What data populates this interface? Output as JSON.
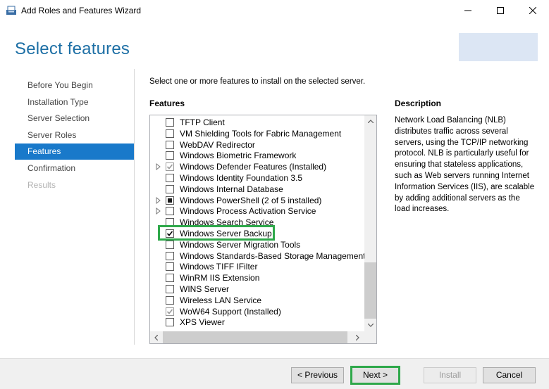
{
  "window": {
    "title": "Add Roles and Features Wizard"
  },
  "page": {
    "title": "Select features"
  },
  "nav": {
    "items": [
      {
        "label": "Before You Begin",
        "state": "normal"
      },
      {
        "label": "Installation Type",
        "state": "normal"
      },
      {
        "label": "Server Selection",
        "state": "normal"
      },
      {
        "label": "Server Roles",
        "state": "normal"
      },
      {
        "label": "Features",
        "state": "active"
      },
      {
        "label": "Confirmation",
        "state": "normal"
      },
      {
        "label": "Results",
        "state": "disabled"
      }
    ]
  },
  "content": {
    "instruction": "Select one or more features to install on the selected server.",
    "features_heading": "Features",
    "description_heading": "Description",
    "description_text": "Network Load Balancing (NLB) distributes traffic across several servers, using the TCP/IP networking protocol. NLB is particularly useful for ensuring that stateless applications, such as Web servers running Internet Information Services (IIS), are scalable by adding additional servers as the load increases."
  },
  "features": [
    {
      "label": "TFTP Client",
      "checked": "none",
      "expandable": false
    },
    {
      "label": "VM Shielding Tools for Fabric Management",
      "checked": "none",
      "expandable": false
    },
    {
      "label": "WebDAV Redirector",
      "checked": "none",
      "expandable": false
    },
    {
      "label": "Windows Biometric Framework",
      "checked": "none",
      "expandable": false
    },
    {
      "label": "Windows Defender Features (Installed)",
      "checked": "installed",
      "expandable": true
    },
    {
      "label": "Windows Identity Foundation 3.5",
      "checked": "none",
      "expandable": false
    },
    {
      "label": "Windows Internal Database",
      "checked": "none",
      "expandable": false
    },
    {
      "label": "Windows PowerShell (2 of 5 installed)",
      "checked": "partial",
      "expandable": true
    },
    {
      "label": "Windows Process Activation Service",
      "checked": "none",
      "expandable": true
    },
    {
      "label": "Windows Search Service",
      "checked": "none",
      "expandable": false
    },
    {
      "label": "Windows Server Backup",
      "checked": "checked",
      "expandable": false
    },
    {
      "label": "Windows Server Migration Tools",
      "checked": "none",
      "expandable": false
    },
    {
      "label": "Windows Standards-Based Storage Management",
      "checked": "none",
      "expandable": false
    },
    {
      "label": "Windows TIFF IFilter",
      "checked": "none",
      "expandable": false
    },
    {
      "label": "WinRM IIS Extension",
      "checked": "none",
      "expandable": false
    },
    {
      "label": "WINS Server",
      "checked": "none",
      "expandable": false
    },
    {
      "label": "Wireless LAN Service",
      "checked": "none",
      "expandable": false
    },
    {
      "label": "WoW64 Support (Installed)",
      "checked": "installed",
      "expandable": false
    },
    {
      "label": "XPS Viewer",
      "checked": "none",
      "expandable": false
    }
  ],
  "buttons": {
    "previous": "< Previous",
    "next": "Next >",
    "install": "Install",
    "cancel": "Cancel"
  },
  "colors": {
    "accent": "#1979ca",
    "title": "#1d6fa5",
    "highlight": "#2ea84a"
  }
}
